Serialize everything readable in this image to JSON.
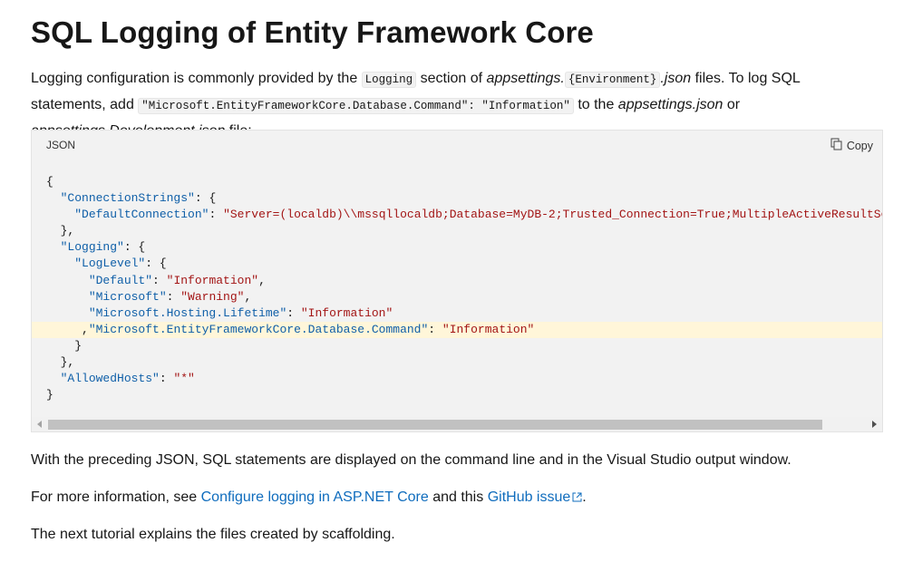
{
  "title": "SQL Logging of Entity Framework Core",
  "intro": {
    "t1": "Logging configuration is commonly provided by the ",
    "c1": "Logging",
    "t2": " section of ",
    "e1": "appsettings.",
    "c2": "{Environment}",
    "e2": ".json",
    "t3": " files. To log SQL statements, add ",
    "c3": "\"Microsoft.EntityFrameworkCore.Database.Command\": \"Information\"",
    "t4": " to the ",
    "e3": "appsettings.json",
    "t5": " or ",
    "e4": "appsettings.Development.json",
    "t6": " file:"
  },
  "codeblock": {
    "language": "JSON",
    "copy_label": "Copy",
    "lines": {
      "l0": "{",
      "l1_key": "\"ConnectionStrings\"",
      "l1_rest": ": {",
      "l2_key": "\"DefaultConnection\"",
      "l2_sep": ": ",
      "l2_val": "\"Server=(localdb)\\\\mssqllocaldb;Database=MyDB-2;Trusted_Connection=True;MultipleActiveResultSets=true\"",
      "l3": "},",
      "l4_key": "\"Logging\"",
      "l4_rest": ": {",
      "l5_key": "\"LogLevel\"",
      "l5_rest": ": {",
      "l6_key": "\"Default\"",
      "l6_val": "\"Information\"",
      "l7_key": "\"Microsoft\"",
      "l7_val": "\"Warning\"",
      "l8_key": "\"Microsoft.Hosting.Lifetime\"",
      "l8_val": "\"Information\"",
      "l9_key": "\"Microsoft.EntityFrameworkCore.Database.Command\"",
      "l9_val": "\"Information\"",
      "l10": "}",
      "l11": "},",
      "l12_key": "\"AllowedHosts\"",
      "l12_val": "\"*\"",
      "l13": "}"
    }
  },
  "para1": "With the preceding JSON, SQL statements are displayed on the command line and in the Visual Studio output window.",
  "para2": {
    "t1": "For more information, see ",
    "link1": "Configure logging in ASP.NET Core",
    "t2": " and this ",
    "link2": "GitHub issue",
    "t3": "."
  },
  "para3": "The next tutorial explains the files created by scaffolding.",
  "colors": {
    "link": "#0f6cbd",
    "json_key": "#0f5fa8",
    "json_string": "#a31515",
    "highlight": "#fff6d9"
  }
}
